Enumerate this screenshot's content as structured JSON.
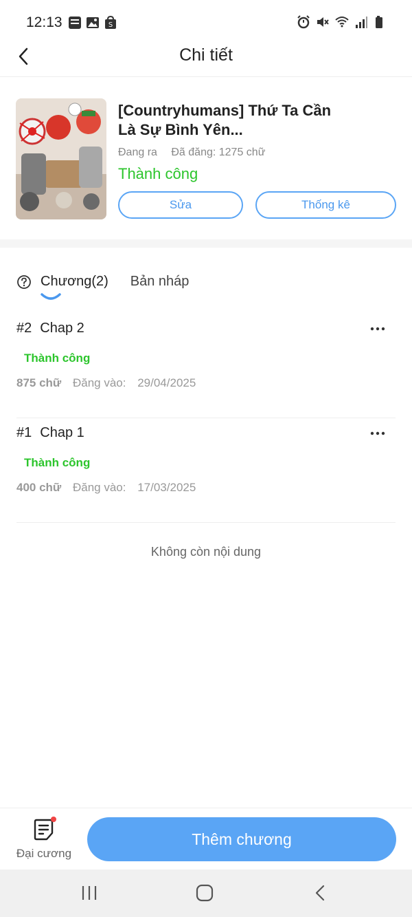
{
  "status_bar": {
    "time": "12:13",
    "left_icons": [
      "news-app-icon",
      "image-icon",
      "shopping-bag-icon"
    ],
    "right_icons": [
      "alarm-icon",
      "mute-icon",
      "wifi-icon",
      "signal-icon",
      "battery-icon"
    ]
  },
  "header": {
    "title": "Chi tiết"
  },
  "story": {
    "title": "[Countryhumans] Thứ Ta Cần Là Sự Bình Yên...",
    "state": "Đang ra",
    "word_count": "Đã đăng: 1275 chữ",
    "status": "Thành công",
    "edit_label": "Sửa",
    "stats_label": "Thống kê"
  },
  "tabs": [
    {
      "label": "Chương(2)",
      "active": true
    },
    {
      "label": "Bản nháp",
      "active": false
    }
  ],
  "chapters": [
    {
      "number": "#2",
      "title": "Chap 2",
      "status": "Thành công",
      "words": "875 chữ",
      "date_label": "Đăng vào:",
      "date": "29/04/2025"
    },
    {
      "number": "#1",
      "title": "Chap 1",
      "status": "Thành công",
      "words": "400 chữ",
      "date_label": "Đăng vào:",
      "date": "17/03/2025"
    }
  ],
  "end_text": "Không còn nội dung",
  "bottom": {
    "outline_label": "Đại cương",
    "add_chapter_label": "Thêm chương"
  },
  "colors": {
    "accent": "#5aa5f5",
    "success": "#2cc52c",
    "notification_dot": "#f04545"
  }
}
